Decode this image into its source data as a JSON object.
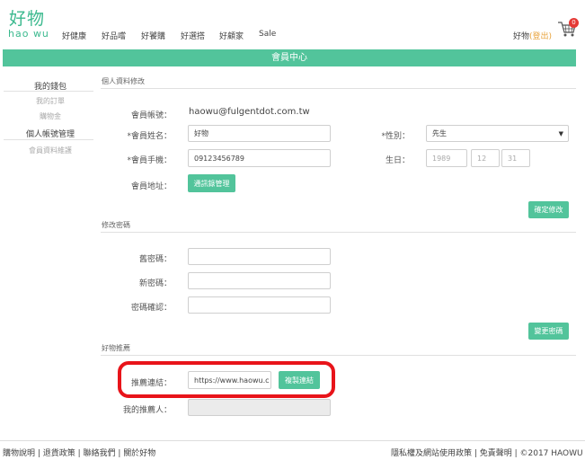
{
  "header": {
    "logo_cn": "好物",
    "logo_en": "hao wu",
    "nav": [
      "好健康",
      "好品嚐",
      "好饕購",
      "好選搭",
      "好顧家",
      "Sale"
    ],
    "user_name": "好物",
    "logout": "(登出)",
    "cart_count": "0"
  },
  "page_title": "會員中心",
  "sidebar": {
    "wallet": "我的錢包",
    "orders": "我的訂單",
    "credits": "購物金",
    "account": "個人帳號管理",
    "profile": "會員資料維護"
  },
  "profile": {
    "section_title": "個人資料修改",
    "account_label": "會員帳號：",
    "account_value": "haowu@fulgentdot.com.tw",
    "name_label": "*會員姓名：",
    "name_value": "好物",
    "gender_label": "*性別：",
    "gender_value": "先生",
    "phone_label": "*會員手機：",
    "phone_value": "09123456789",
    "birthday_label": "生日：",
    "birth_year": "1989",
    "birth_month": "12",
    "birth_day": "31",
    "address_label": "會員地址：",
    "address_button": "通訊錄管理",
    "confirm_button": "確定修改"
  },
  "password": {
    "section_title": "修改密碼",
    "old_label": "舊密碼：",
    "new_label": "新密碼：",
    "confirm_label": "密碼確認：",
    "change_button": "變更密碼"
  },
  "referral": {
    "section_title": "好物推薦",
    "link_label": "推薦連結：",
    "link_value": "https://www.haowu.c",
    "copy_button": "複製連結",
    "referrer_label": "我的推薦人："
  },
  "footer": {
    "left": "購物說明 | 退貨政策 | 聯絡我們 | 關於好物",
    "right": "隱私權及網站使用政策 | 免責聲明 | ©2017 HAOWU"
  },
  "colors": {
    "brand": "#52c49b",
    "logout": "#e8a23a",
    "highlight": "#e8141a",
    "badge": "#e53935"
  }
}
